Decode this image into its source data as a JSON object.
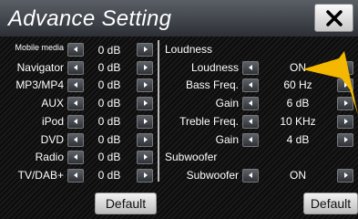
{
  "header": {
    "title": "Advance Setting"
  },
  "left_rows": [
    {
      "label": "Mobile media",
      "value": "0 dB"
    },
    {
      "label": "Navigator",
      "value": "0 dB"
    },
    {
      "label": "MP3/MP4",
      "value": "0 dB"
    },
    {
      "label": "AUX",
      "value": "0 dB"
    },
    {
      "label": "iPod",
      "value": "0 dB"
    },
    {
      "label": "DVD",
      "value": "0 dB"
    },
    {
      "label": "Radio",
      "value": "0 dB"
    },
    {
      "label": "TV/DAB+",
      "value": "0 dB"
    }
  ],
  "right": {
    "loudness_section": "Loudness",
    "subwoofer_section": "Subwoofer",
    "rows": [
      {
        "label": "Loudness",
        "value": "ON"
      },
      {
        "label": "Bass Freq.",
        "value": "60 Hz"
      },
      {
        "label": "Gain",
        "value": "6 dB"
      },
      {
        "label": "Treble Freq.",
        "value": "10 KHz"
      },
      {
        "label": "Gain",
        "value": "4 dB"
      },
      {
        "label": "Subwoofer",
        "value": "ON"
      }
    ]
  },
  "buttons": {
    "default_left": "Default",
    "default_right": "Default"
  },
  "icons": {
    "close": "close-icon",
    "left": "arrow-left-icon",
    "right": "arrow-right-icon"
  },
  "colors": {
    "pointer": "#f5b800"
  }
}
